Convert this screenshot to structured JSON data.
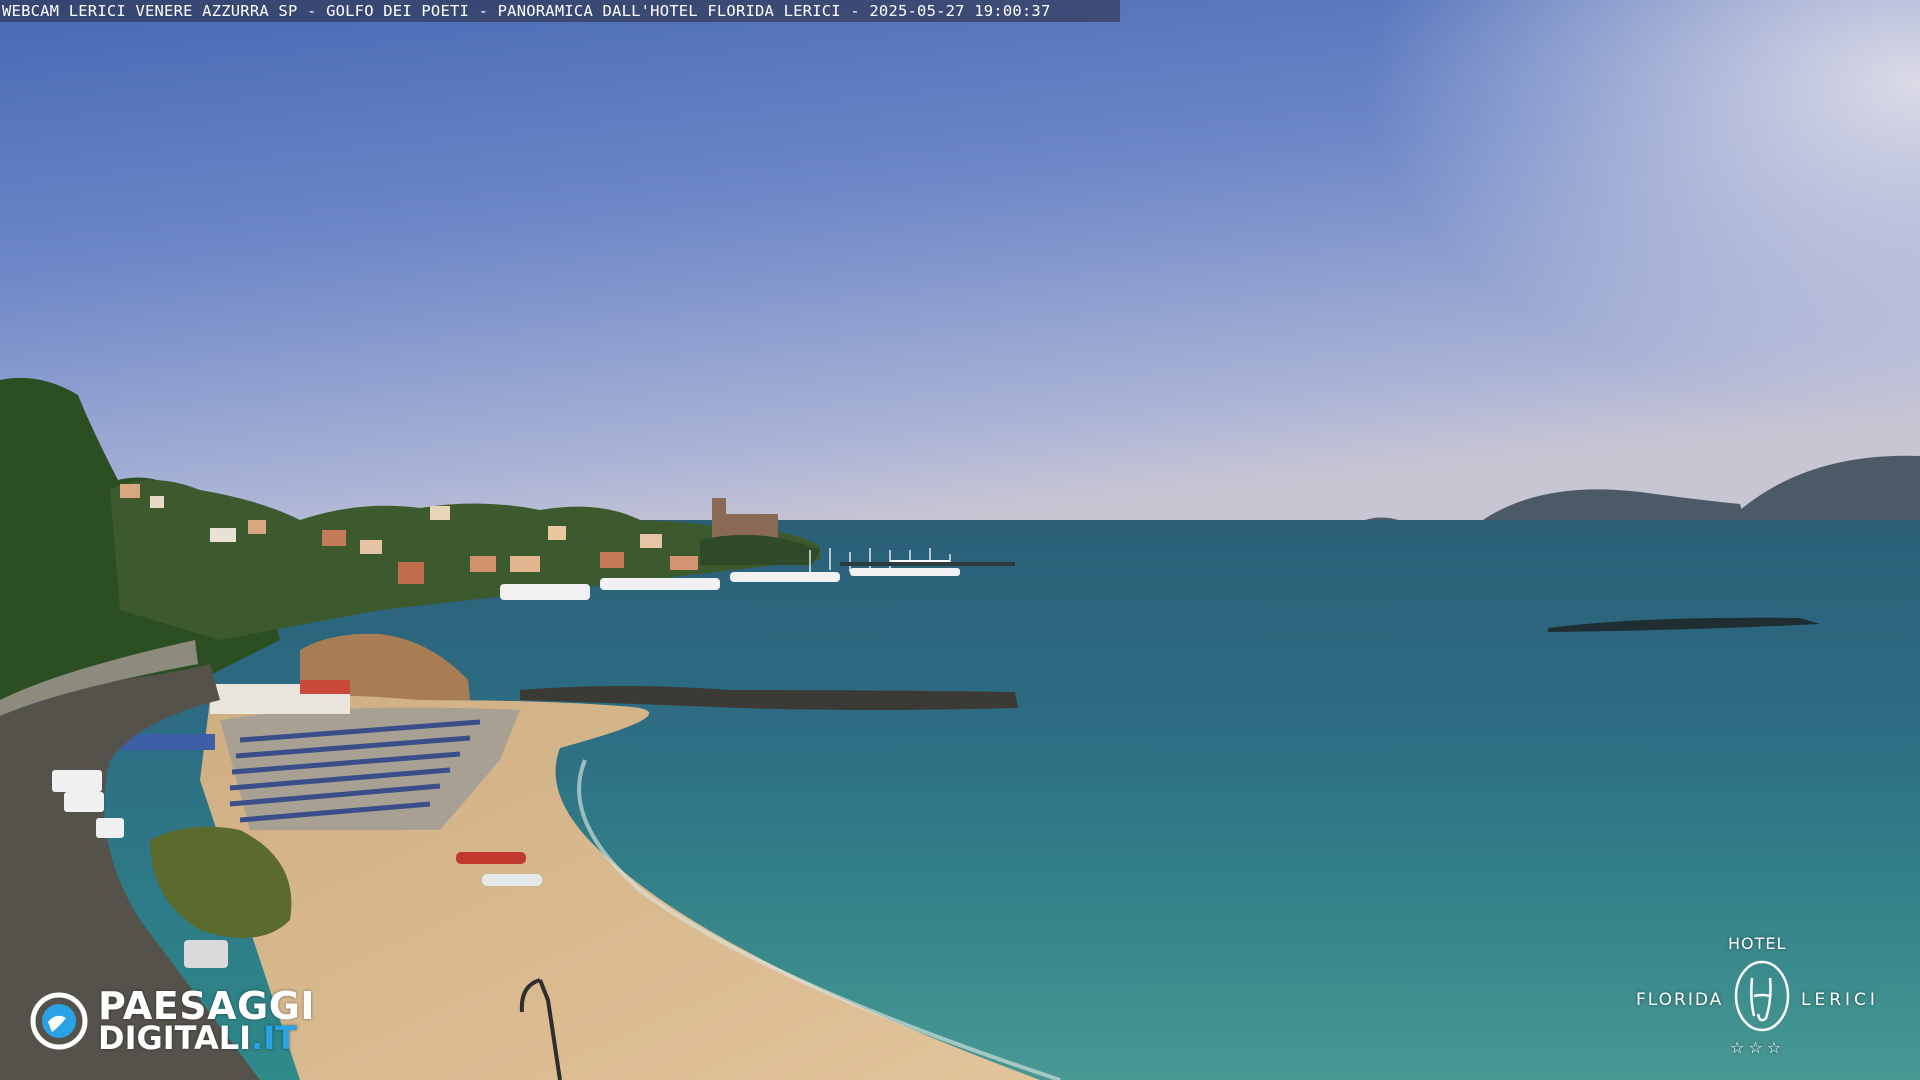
{
  "overlay": {
    "title": "WEBCAM LERICI VENERE AZZURRA SP - GOLFO DEI POETI - PANORAMICA DALL'HOTEL FLORIDA LERICI - 2025-05-27 19:00:37"
  },
  "logo_paesaggi": {
    "line1": "PAESAGGI",
    "line2_a": "DIGITALI",
    "line2_b": ".IT",
    "icon": "paesaggi-globe-icon"
  },
  "logo_hotel": {
    "hotel": "HOTEL",
    "left": "FLORIDA",
    "right": "LERICI",
    "stars": "☆☆☆",
    "monogram": "HF"
  },
  "colors": {
    "sky_top": "#4a6fb8",
    "sky_horizon": "#c7c9d6",
    "sea_deep": "#2c6a80",
    "sea_near": "#2f8a8c",
    "sand": "#d9b98e",
    "vegetation": "#2f5a2a",
    "brand_blue": "#2aa3e6"
  }
}
